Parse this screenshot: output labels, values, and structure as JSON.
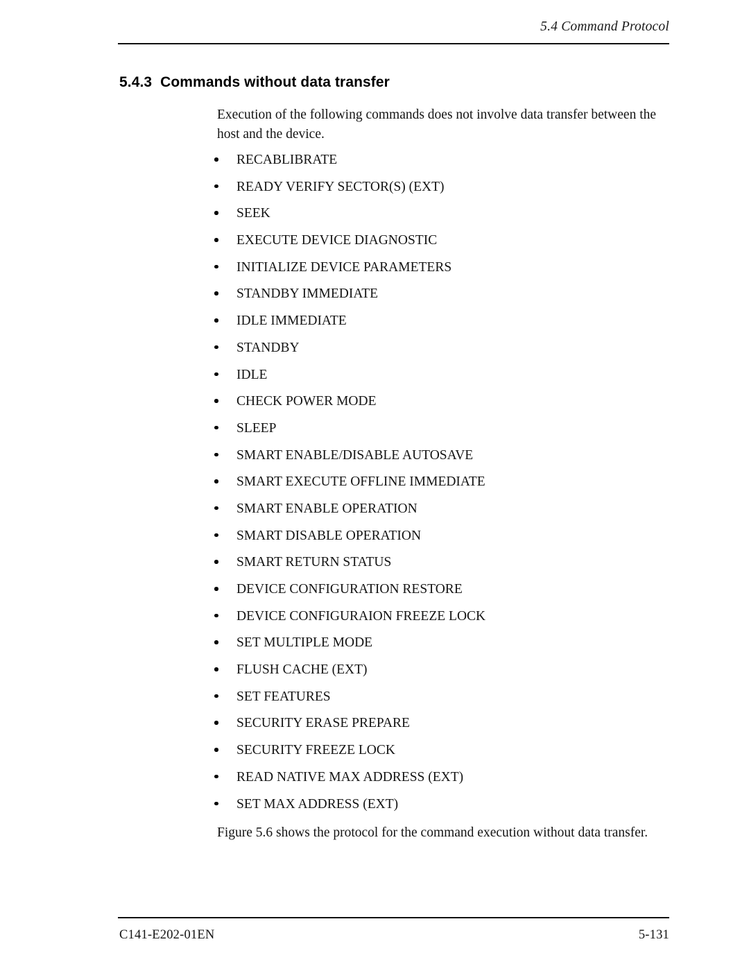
{
  "header": {
    "running_title": "5.4  Command Protocol"
  },
  "section": {
    "heading": "5.4.3  Commands without data transfer",
    "intro_paragraph": "Execution of the following commands does not involve data transfer between the host and the device.",
    "closing_paragraph": "Figure 5.6 shows the protocol for the command execution without data transfer."
  },
  "commands": [
    {
      "label": "RECABLIBRATE"
    },
    {
      "label": "READY VERIFY SECTOR(S) (EXT)"
    },
    {
      "label": "SEEK"
    },
    {
      "label": "EXECUTE DEVICE DIAGNOSTIC"
    },
    {
      "label": "INITIALIZE DEVICE PARAMETERS"
    },
    {
      "label": "STANDBY IMMEDIATE"
    },
    {
      "label": "IDLE IMMEDIATE"
    },
    {
      "label": "STANDBY"
    },
    {
      "label": "IDLE"
    },
    {
      "label": "CHECK POWER MODE"
    },
    {
      "label": "SLEEP"
    },
    {
      "label": "SMART ENABLE/DISABLE AUTOSAVE"
    },
    {
      "label": "SMART EXECUTE OFFLINE IMMEDIATE"
    },
    {
      "label": "SMART ENABLE OPERATION"
    },
    {
      "label": "SMART DISABLE OPERATION"
    },
    {
      "label": "SMART RETURN STATUS"
    },
    {
      "label": "DEVICE CONFIGURATION RESTORE"
    },
    {
      "label": "DEVICE CONFIGURAION FREEZE LOCK"
    },
    {
      "label": "SET MULTIPLE MODE"
    },
    {
      "label": "FLUSH CACHE (EXT)"
    },
    {
      "label": "SET FEATURES"
    },
    {
      "label": "SECURITY ERASE PREPARE"
    },
    {
      "label": "SECURITY FREEZE LOCK"
    },
    {
      "label": "READ NATIVE MAX ADDRESS (EXT)"
    },
    {
      "label": "SET MAX ADDRESS (EXT)"
    }
  ],
  "footer": {
    "document_number": "C141-E202-01EN",
    "page_number": "5-131"
  }
}
